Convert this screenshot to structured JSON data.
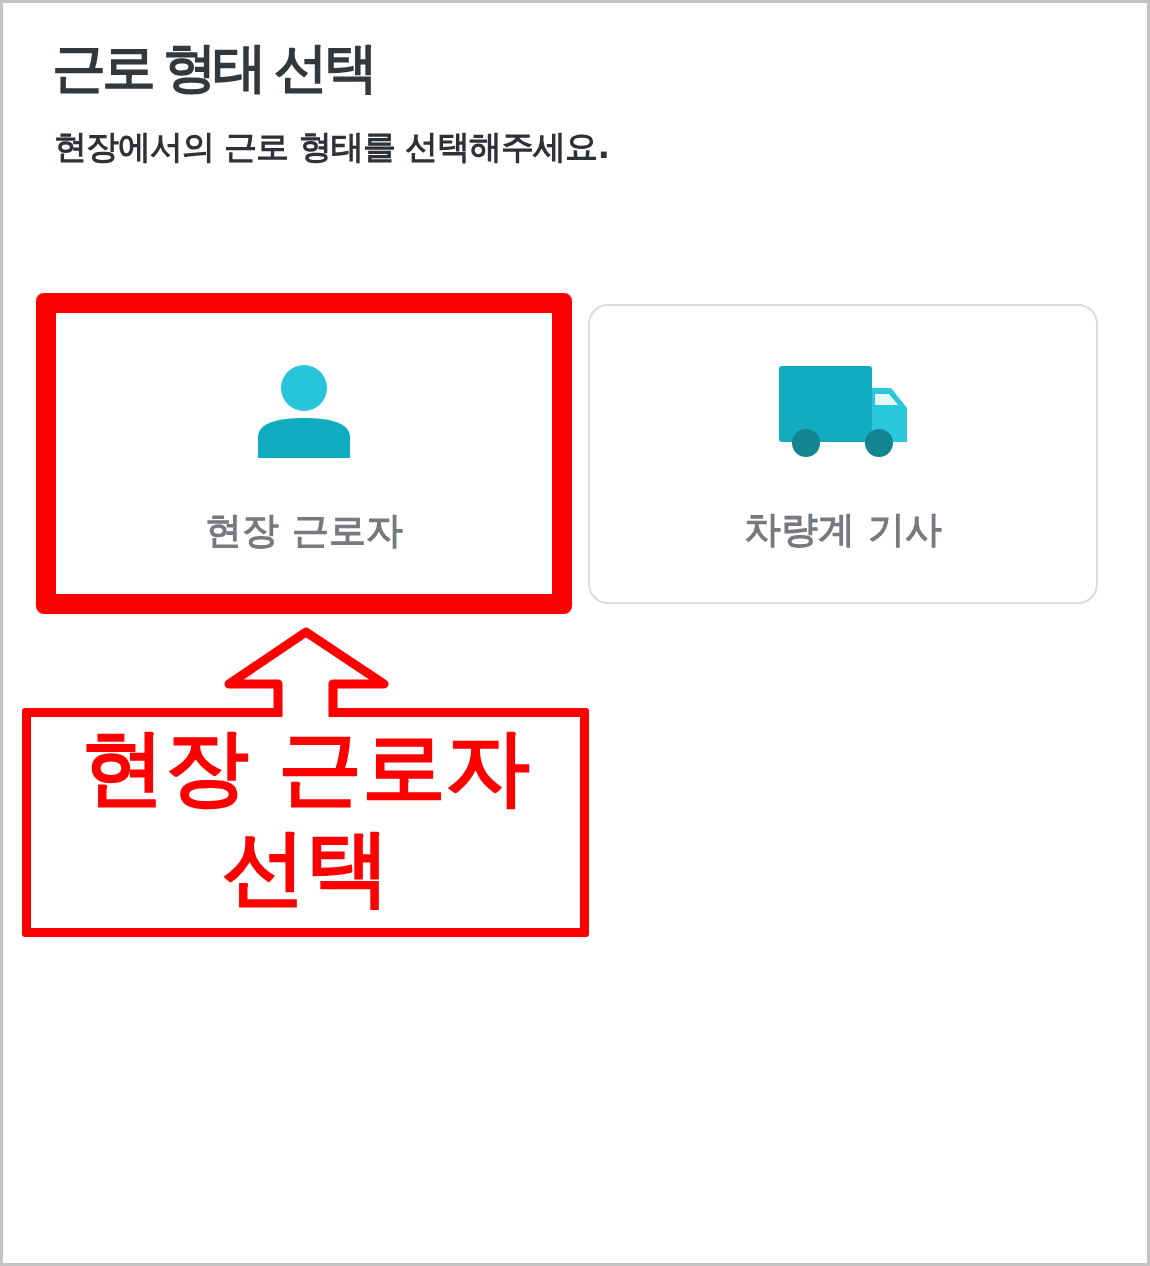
{
  "title": "근로 형태 선택",
  "subtitle": "현장에서의 근로 형태를 선택해주세요.",
  "options": [
    {
      "label": "현장 근로자",
      "kind": "worker",
      "highlighted": true
    },
    {
      "label": "차량계 기사",
      "kind": "driver",
      "highlighted": false
    }
  ],
  "callout": {
    "text": "현장 근로자 선택"
  }
}
